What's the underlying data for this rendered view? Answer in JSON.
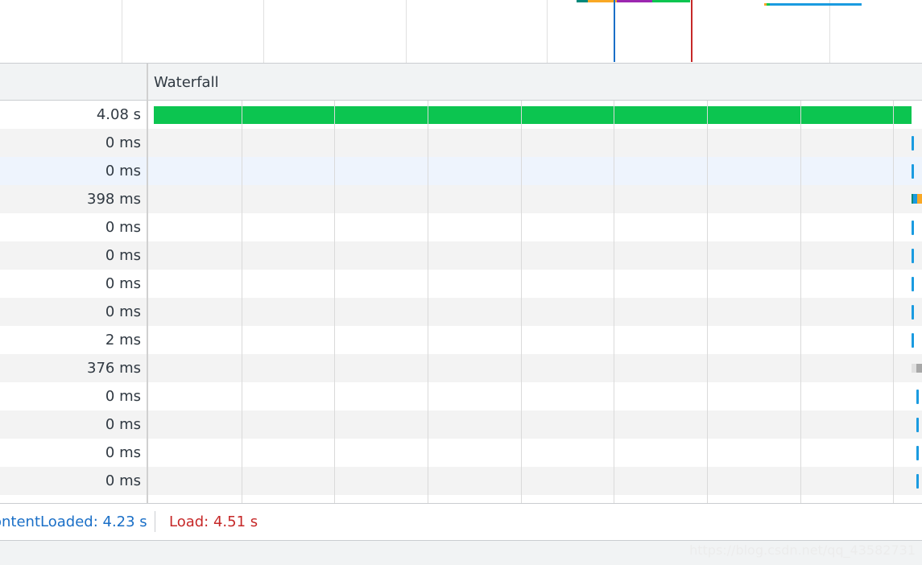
{
  "overview": {
    "segment_colors": [
      "#00897b",
      "#f9a825",
      "#9c27b0",
      "#0cc550",
      "#1a9be0"
    ],
    "dom_content_loaded_line_color": "#1a6fc7",
    "load_line_color": "#c62828"
  },
  "table": {
    "time_header": "",
    "waterfall_header": "Waterfall",
    "rows": [
      {
        "time": "4.08 s",
        "bar": "green-long"
      },
      {
        "time": "0 ms",
        "bar": "tick"
      },
      {
        "time": "0 ms",
        "bar": "tick",
        "selected": true
      },
      {
        "time": "398 ms",
        "bar": "multi"
      },
      {
        "time": "0 ms",
        "bar": "tick"
      },
      {
        "time": "0 ms",
        "bar": "tick"
      },
      {
        "time": "0 ms",
        "bar": "tick"
      },
      {
        "time": "0 ms",
        "bar": "tick"
      },
      {
        "time": "2 ms",
        "bar": "tick"
      },
      {
        "time": "376 ms",
        "bar": "gray"
      },
      {
        "time": "0 ms",
        "bar": "tick"
      },
      {
        "time": "0 ms",
        "bar": "tick"
      },
      {
        "time": "0 ms",
        "bar": "tick"
      },
      {
        "time": "0 ms",
        "bar": "tick"
      },
      {
        "time": "",
        "bar": "partial"
      }
    ]
  },
  "summary": {
    "dom_content_loaded": "ontentLoaded: 4.23 s",
    "load": "Load: 4.51 s"
  },
  "watermark": "https://blog.csdn.net/qq_43582731"
}
